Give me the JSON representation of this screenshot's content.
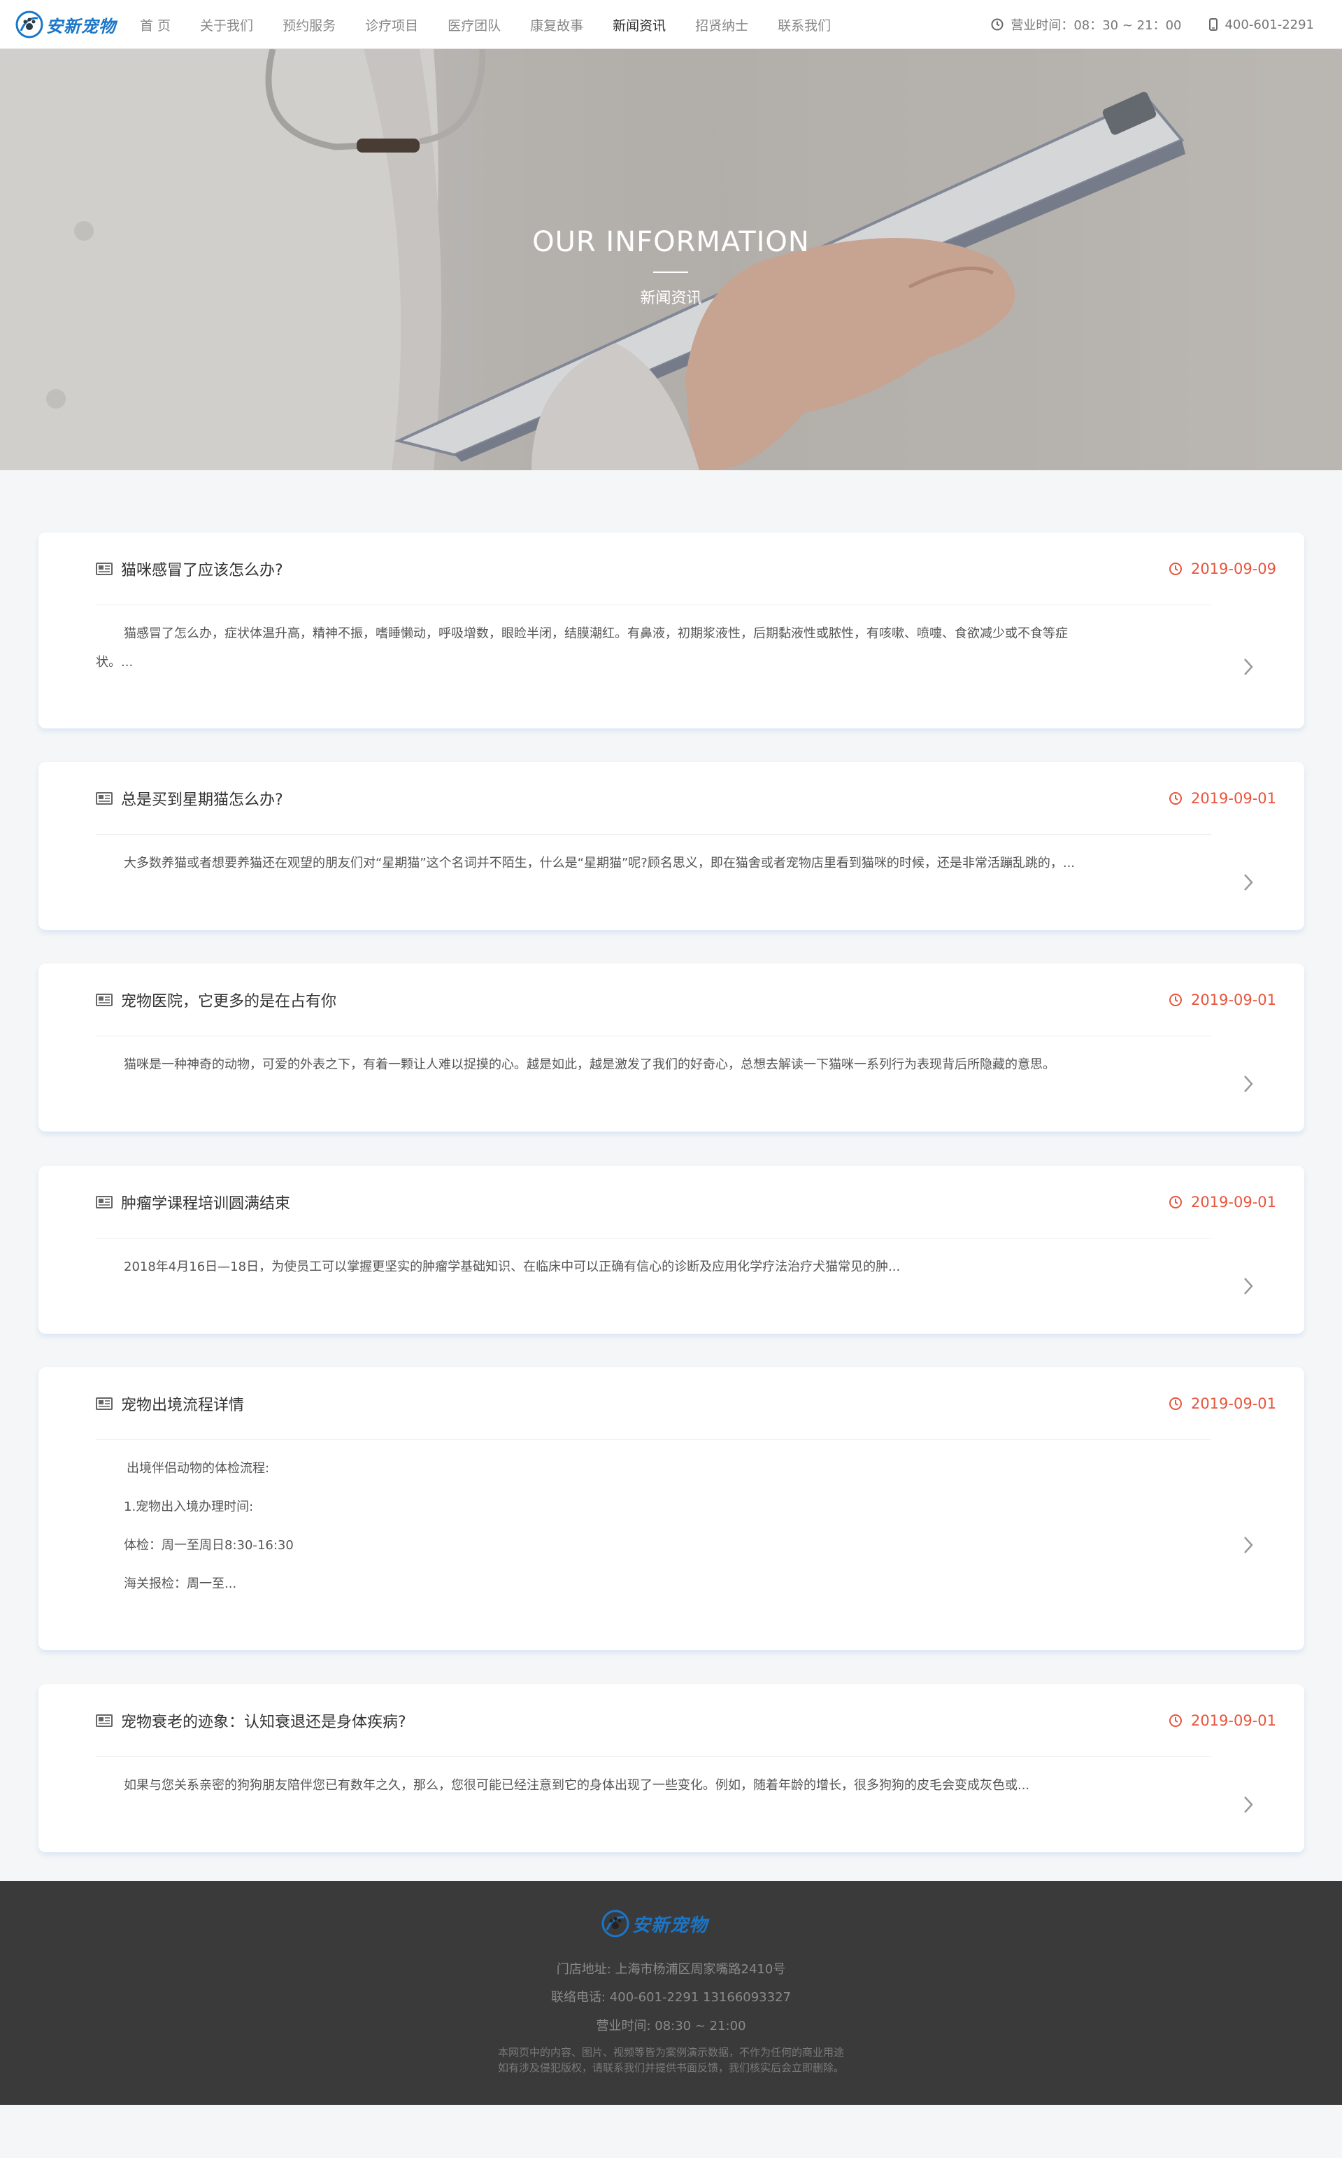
{
  "header": {
    "brand": "安新宠物",
    "nav": [
      "首 页",
      "关于我们",
      "预约服务",
      "诊疗项目",
      "医疗团队",
      "康复故事",
      "新闻资讯",
      "招贤纳士",
      "联系我们"
    ],
    "active_index": 6,
    "hours": "营业时间：08：30 ~ 21：00",
    "phone": "400-601-2291"
  },
  "banner": {
    "title": "OUR INFORMATION",
    "subtitle": "新闻资讯"
  },
  "articles": [
    {
      "title": "猫咪感冒了应该怎么办?",
      "date": "2019-09-09",
      "body": [
        "猫感冒了怎么办，症状体温升高，精神不振，嗜睡懒动，呼吸增数，眼睑半闭，结膜潮红。有鼻液，初期浆液性，后期黏液性或脓性，有咳嗽、喷嚏、食欲减少或不食等症状。..."
      ]
    },
    {
      "title": "总是买到星期猫怎么办?",
      "date": "2019-09-01",
      "body": [
        "大多数养猫或者想要养猫还在观望的朋友们对“星期猫”这个名词并不陌生，什么是“星期猫”呢?顾名思义，即在猫舍或者宠物店里看到猫咪的时候，还是非常活蹦乱跳的，..."
      ]
    },
    {
      "title": "宠物医院，它更多的是在占有你",
      "date": "2019-09-01",
      "body": [
        "猫咪是一种神奇的动物，可爱的外表之下，有着一颗让人难以捉摸的心。越是如此，越是激发了我们的好奇心，总想去解读一下猫咪一系列行为表现背后所隐藏的意思。"
      ]
    },
    {
      "title": "肿瘤学课程培训圆满结束",
      "date": "2019-09-01",
      "body": [
        "2018年4月16日—18日，为使员工可以掌握更坚实的肿瘤学基础知识、在临床中可以正确有信心的诊断及应用化学疗法治疗犬猫常见的肿..."
      ]
    },
    {
      "title": "宠物出境流程详情",
      "date": "2019-09-01",
      "body": [
        "出境伴侣动物的体检流程:",
        "1.宠物出入境办理时间:",
        "体检：周一至周日8:30-16:30",
        "海关报检：周一至..."
      ]
    },
    {
      "title": "宠物衰老的迹象：认知衰退还是身体疾病?",
      "date": "2019-09-01",
      "body": [
        "如果与您关系亲密的狗狗朋友陪伴您已有数年之久，那么，您很可能已经注意到它的身体出现了一些变化。例如，随着年龄的增长，很多狗狗的皮毛会变成灰色或..."
      ]
    }
  ],
  "footer": {
    "brand": "安新宠物",
    "address": "门店地址: 上海市杨浦区周家嘴路2410号",
    "tel": "联络电话: 400-601-2291  13166093327",
    "hours": "营业时间: 08:30 ~ 21:00",
    "disclaimer1": "本网页中的内容、图片、视频等皆为案例演示数据，不作为任何的商业用途",
    "disclaimer2": "如有涉及侵犯版权，请联系我们并提供书面反馈，我们核实后会立即删除。"
  },
  "colors": {
    "accent": "#e8543c",
    "brand": "#1a76c9",
    "footer_bg": "#3a3a3a"
  }
}
